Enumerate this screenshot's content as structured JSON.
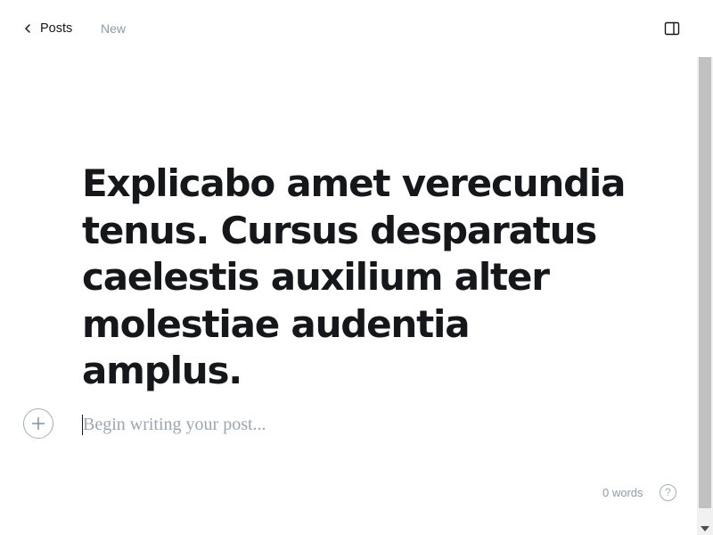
{
  "header": {
    "back_label": "Posts",
    "status": "New",
    "back_icon": "chevron-left-icon",
    "sidebar_icon": "sidebar-toggle-icon"
  },
  "editor": {
    "title": "Explicabo amet verecundia tenus. Cursus desparatus caelestis auxilium alter molestiae audentia amplus.",
    "body_placeholder": "Begin writing your post...",
    "body_value": "",
    "add_card_icon": "plus-icon"
  },
  "footer": {
    "word_count": "0 words",
    "help_label": "?",
    "help_icon": "question-icon"
  },
  "colors": {
    "text": "#15171a",
    "muted": "#8e9aa6",
    "placeholder": "#9aa7b3",
    "border": "#a4aeb7"
  }
}
